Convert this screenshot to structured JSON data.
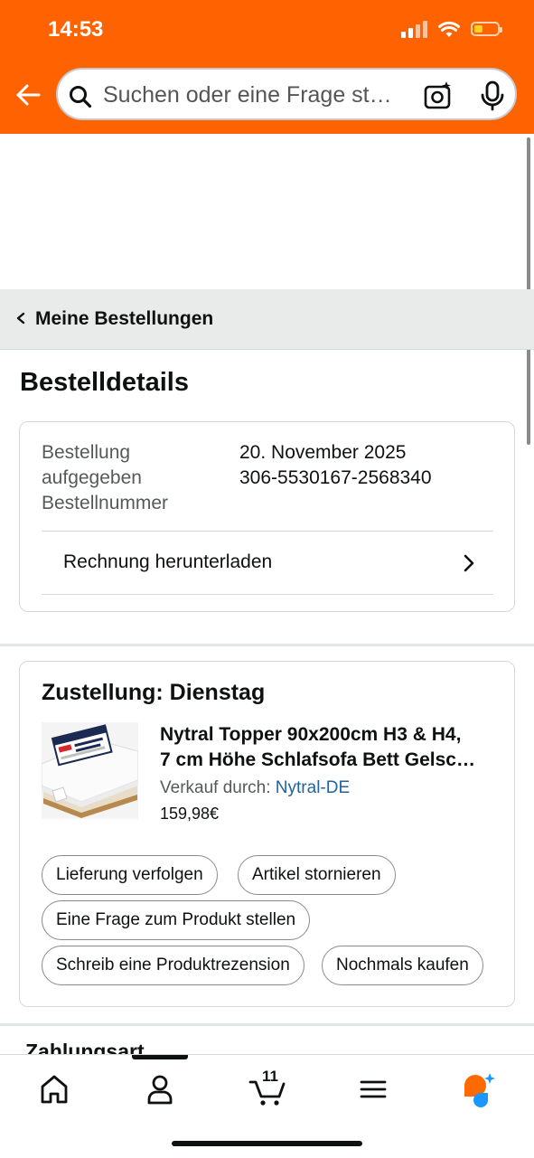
{
  "status_bar": {
    "time": "14:53"
  },
  "search": {
    "placeholder": "Suchen oder eine Frage st…"
  },
  "breadcrumb": {
    "label": "Meine Bestellungen"
  },
  "page": {
    "title": "Bestelldetails"
  },
  "order": {
    "placed_label_line1": "Bestellung",
    "placed_label_line2": "aufgegeben",
    "number_label": "Bestellnummer",
    "date": "20. November 2025",
    "number": "306-5530167-2568340",
    "invoice_label": "Rechnung herunterladen"
  },
  "shipment": {
    "title": "Zustellung: Dienstag",
    "product_title_line1": "Nytral Topper 90x200cm H3 & H4,",
    "product_title_line2": "7 cm Höhe Schlafsofa Bett Gelsc…",
    "seller_prefix": "Verkauf durch: ",
    "seller_name": "Nytral-DE",
    "price": "159,98€",
    "actions": {
      "track": "Lieferung verfolgen",
      "cancel": "Artikel stornieren",
      "ask": "Eine Frage zum Produkt stellen",
      "review": "Schreib eine Produktrezension",
      "rebuy": "Nochmals kaufen"
    }
  },
  "payment": {
    "title": "Zahlungsart"
  },
  "tabbar": {
    "cart_count": "11"
  },
  "colors": {
    "header": "#ff6200",
    "link": "#2162a1",
    "ai_orange": "#ff6a00",
    "ai_blue": "#1a98ff"
  }
}
